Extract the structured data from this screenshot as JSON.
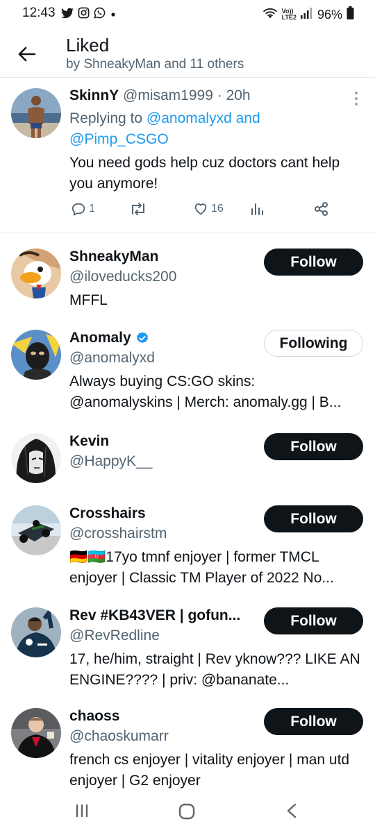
{
  "status_bar": {
    "time": "12:43",
    "network_top": "Vo))",
    "network_bottom": "LTE2",
    "battery": "96%"
  },
  "header": {
    "title": "Liked",
    "subtitle": "by ShneakyMan and 11 others"
  },
  "tweet": {
    "name": "SkinnY",
    "handle": "@misam1999",
    "separator": " · ",
    "time": "20h",
    "replying_prefix": "Replying to ",
    "reply_user_1": "@anomalyxd",
    "reply_and": " and",
    "reply_user_2": "@Pimp_CSGO",
    "text": "You need gods help cuz doctors cant help you anymore!",
    "reply_count": "1",
    "like_count": "16"
  },
  "users": [
    {
      "name": "ShneakyMan",
      "handle": "@iloveducks200",
      "bio": "MFFL",
      "button": "Follow"
    },
    {
      "name": "Anomaly",
      "handle": "@anomalyxd",
      "bio": "Always buying CS:GO skins: @anomalyskins | Merch: anomaly.gg | B...",
      "button": "Following"
    },
    {
      "name": "Kevin",
      "handle": "@HappyK__",
      "bio": "",
      "button": "Follow"
    },
    {
      "name": "Crosshairs",
      "handle": "@crosshairstm",
      "bio": "🇩🇪🇦🇿17yo tmnf enjoyer | former TMCL enjoyer | Classic TM Player of 2022 No...",
      "button": "Follow"
    },
    {
      "name": "Rev #KB43VER | gofun...",
      "handle": "@RevRedline",
      "bio": "17, he/him, straight | Rev yknow??? LIKE AN ENGINE???? | priv: @bananate...",
      "button": "Follow"
    },
    {
      "name": "chaoss",
      "handle": "@chaoskumarr",
      "bio": "french cs enjoyer | vitality enjoyer | man utd enjoyer | G2 enjoyer",
      "button": "Follow"
    }
  ],
  "colors": {
    "primary_text": "#0f1419",
    "secondary_text": "#536471",
    "link": "#1d9bf0",
    "verified": "#1d9bf0",
    "follow_bg": "#0f1419"
  }
}
